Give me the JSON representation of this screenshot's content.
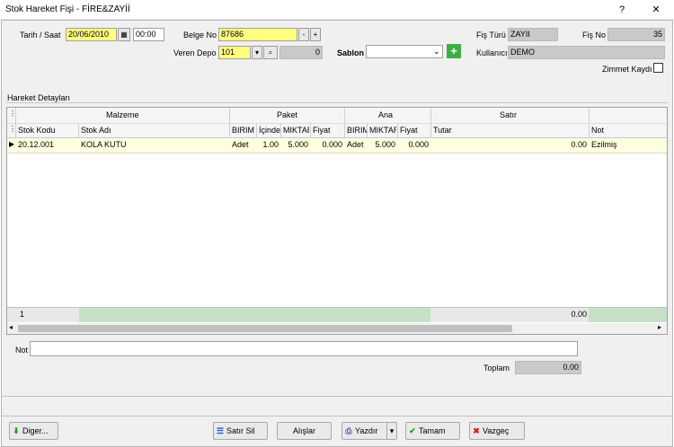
{
  "window": {
    "title": "Stok Hareket Fişi - FİRE&ZAYİİ",
    "help": "?",
    "close": "✕"
  },
  "header": {
    "tarih_label": "Tarih / Saat",
    "tarih_value": "20/06/2010",
    "saat_value": "00:00",
    "belge_label": "Belge No",
    "belge_value": "87686",
    "minus": "-",
    "plus": "+",
    "depo_label": "Veren Depo",
    "depo_value": "101",
    "depo_qty": "0",
    "sablon_label": "Sablon",
    "sablon_value": "",
    "fis_turu_label": "Fiş Türü",
    "fis_turu_value": "ZAYII",
    "fis_no_label": "Fiş No",
    "fis_no_value": "35",
    "kullanici_label": "Kullanıcı",
    "kullanici_value": "DEMO",
    "zimmet_label": "Zimmet Kaydı"
  },
  "section_label": "Hareket Detayları",
  "grid": {
    "groups": {
      "malzeme": "Malzeme",
      "paket": "Paket",
      "ana": "Ana",
      "satir": "Satır"
    },
    "columns": {
      "stok_kodu": "Stok Kodu",
      "stok_adi": "Stok Adı",
      "p_birim": "BIRIM",
      "p_icinde": "İçinde",
      "p_miktar": "MIKTAR",
      "p_fiyat": "Fiyat",
      "a_birim": "BIRIM",
      "a_miktar": "MIKTAR",
      "a_fiyat": "Fiyat",
      "tutar": "Tutar",
      "not": "Not"
    },
    "row": {
      "stok_kodu": "20.12.001",
      "stok_adi": "KOLA KUTU",
      "p_birim": "Adet",
      "p_icinde": "1.00",
      "p_miktar": "5.000",
      "p_fiyat": "0.000",
      "a_birim": "Adet",
      "a_miktar": "5.000",
      "a_fiyat": "0.000",
      "tutar": "0.00",
      "not": "Ezilmiş"
    },
    "footer": {
      "count": "1",
      "total": "0.00"
    }
  },
  "bottom": {
    "not_label": "Not",
    "not_value": "",
    "toplam_label": "Toplam",
    "toplam_value": "0.00"
  },
  "buttons": {
    "diger": "Diger...",
    "satir_sil": "Satır Sil",
    "alislar": "Alışlar",
    "yazdir": "Yazdır",
    "tamam": "Tamam",
    "vazgec": "Vazgeç"
  },
  "colors": {
    "yellow_field": "#ffff80",
    "row_highlight": "#ffffe0",
    "footer_green": "#c8e0c8"
  }
}
